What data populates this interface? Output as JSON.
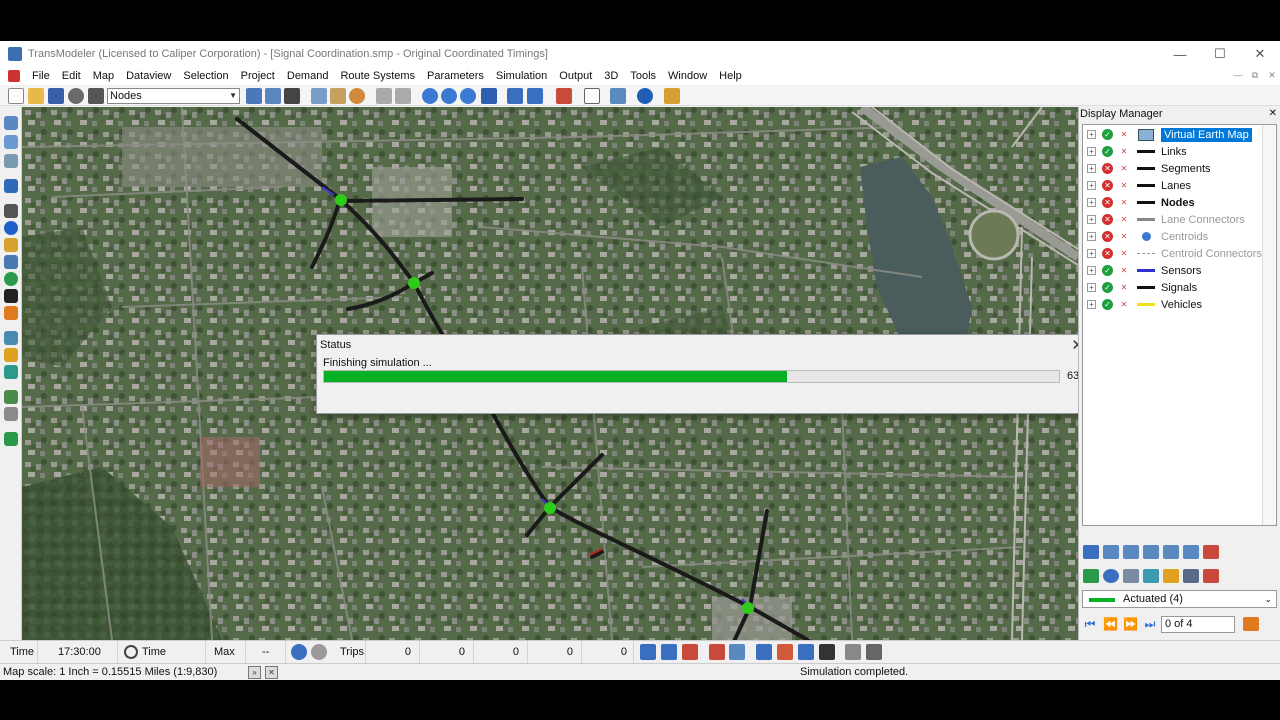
{
  "window": {
    "title": "TransModeler (Licensed to Caliper Corporation) - [Signal Coordination.smp - Original Coordinated Timings]",
    "minimize": "—",
    "maximize": "☐",
    "close": "✕"
  },
  "menu": [
    "File",
    "Edit",
    "Map",
    "Dataview",
    "Selection",
    "Project",
    "Demand",
    "Route Systems",
    "Parameters",
    "Simulation",
    "Output",
    "3D",
    "Tools",
    "Window",
    "Help"
  ],
  "toolbar": {
    "layer_select": "Nodes"
  },
  "status_dialog": {
    "title": "Status",
    "close": "✕",
    "message": "Finishing simulation ...",
    "progress": 0.63,
    "percent_text": "63%"
  },
  "display_manager": {
    "title": "Display Manager",
    "close": "✕",
    "layers": [
      {
        "name": "Virtual Earth Map",
        "visible": true,
        "symbol": "map",
        "style": "selected"
      },
      {
        "name": "Links",
        "visible": true,
        "symbol": "line-black",
        "style": "normal"
      },
      {
        "name": "Segments",
        "visible": false,
        "symbol": "line-black",
        "style": "normal"
      },
      {
        "name": "Lanes",
        "visible": false,
        "symbol": "line-black",
        "style": "normal"
      },
      {
        "name": "Nodes",
        "visible": false,
        "symbol": "line-black",
        "style": "bold"
      },
      {
        "name": "Lane Connectors",
        "visible": false,
        "symbol": "line-gray",
        "style": "dim"
      },
      {
        "name": "Centroids",
        "visible": false,
        "symbol": "dot-blue",
        "style": "dim"
      },
      {
        "name": "Centroid Connectors",
        "visible": false,
        "symbol": "dash-gray",
        "style": "dim"
      },
      {
        "name": "Sensors",
        "visible": true,
        "symbol": "line-blue",
        "style": "normal"
      },
      {
        "name": "Signals",
        "visible": true,
        "symbol": "line-black",
        "style": "normal"
      },
      {
        "name": "Vehicles",
        "visible": true,
        "symbol": "line-yellow",
        "style": "normal"
      }
    ],
    "legend_select": "Actuated (4)",
    "page_text": "0 of 4"
  },
  "simbar": {
    "time_label": "Time",
    "time_value": "17:30:00",
    "time_factors_label": "Time Factors",
    "max_label": "Max",
    "max_value": "--",
    "trips_label": "Trips",
    "counts": [
      "0",
      "0",
      "0",
      "0",
      "0"
    ]
  },
  "statusbar": {
    "map_scale": "Map scale: 1 Inch = 0.15515 Miles (1:9,830)",
    "message": "Simulation completed."
  },
  "colors": {
    "progress_fill": "#06b025",
    "node_marker": "#2ecc1a",
    "road": "#1a1a1a",
    "selection_highlight": "#0078d7"
  }
}
